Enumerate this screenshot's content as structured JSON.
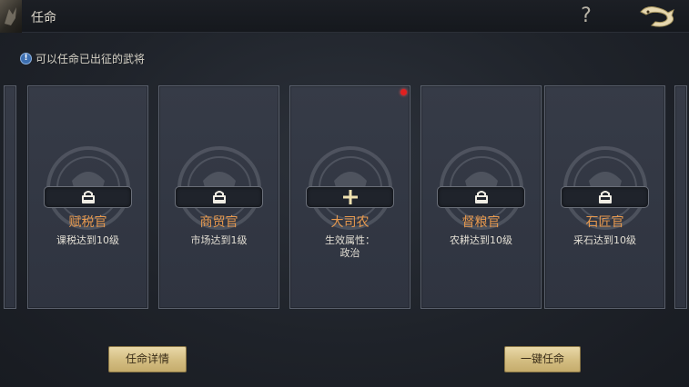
{
  "header": {
    "title": "任命",
    "help_label": "?"
  },
  "notice": {
    "icon_text": "!",
    "text": "可以任命已出征的武将"
  },
  "cards": [
    {
      "name": "赋税官",
      "requirement": "课税达到10级",
      "state": "locked",
      "icon": "lock-icon"
    },
    {
      "name": "商贸官",
      "requirement": "市场达到1级",
      "state": "locked",
      "icon": "lock-icon"
    },
    {
      "name": "大司农",
      "requirement": "生效属性：\n政治",
      "state": "available",
      "icon": "plus-icon",
      "has_alert": true
    },
    {
      "name": "督粮官",
      "requirement": "农耕达到10级",
      "state": "locked",
      "icon": "lock-icon"
    },
    {
      "name": "石匠官",
      "requirement": "采石达到10级",
      "state": "locked",
      "icon": "lock-icon"
    }
  ],
  "buttons": {
    "details": "任命详情",
    "one_click": "一键任命"
  },
  "colors": {
    "role_name": "#e89a4f",
    "button_gold": "#d5bf84",
    "alert_dot": "#e02020"
  }
}
